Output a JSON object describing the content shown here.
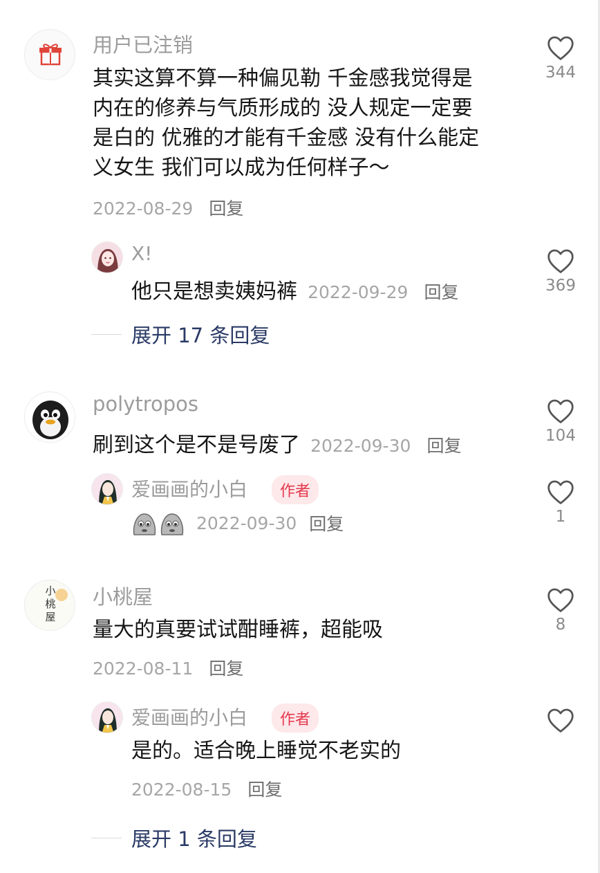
{
  "reply_label": "回复",
  "comments": [
    {
      "user": "用户已注销",
      "text_lines": [
        "其实这算不算一种偏见勒 千金感我觉得是",
        "内在的修养与气质形成的 没人规定一定要",
        "是白的 优雅的才能有千金感 没有什么能定",
        "义女生 我们可以成为任何样子～"
      ],
      "date": "2022-08-29",
      "likes": "344",
      "avatar_icon": "gift-icon",
      "reply": {
        "user": "X!",
        "text": "他只是想卖姨妈裤",
        "date": "2022-09-29",
        "likes": "369"
      },
      "expand": "展开 17 条回复"
    },
    {
      "user": "polytropos",
      "text": "刷到这个是不是号废了",
      "date": "2022-09-30",
      "likes": "104",
      "avatar_icon": "penguin-icon",
      "reply": {
        "user": "爱画画的小白",
        "badge": "作者",
        "date": "2022-09-30",
        "likes": "1",
        "emoji": "crying-face-emoji"
      }
    },
    {
      "user": "小桃屋",
      "text": "量大的真要试试酣睡裤，超能吸",
      "date": "2022-08-11",
      "likes": "8",
      "avatar_text": [
        "小",
        "桃",
        "屋"
      ],
      "reply": {
        "user": "爱画画的小白",
        "badge": "作者",
        "text": "是的。适合晚上睡觉不老实的",
        "date": "2022-08-15",
        "likes": ""
      },
      "expand": "展开 1 条回复"
    }
  ],
  "colors": {
    "accent_link": "#2a3a66",
    "badge_text": "#e4394d",
    "badge_bg": "#fde8ea"
  }
}
